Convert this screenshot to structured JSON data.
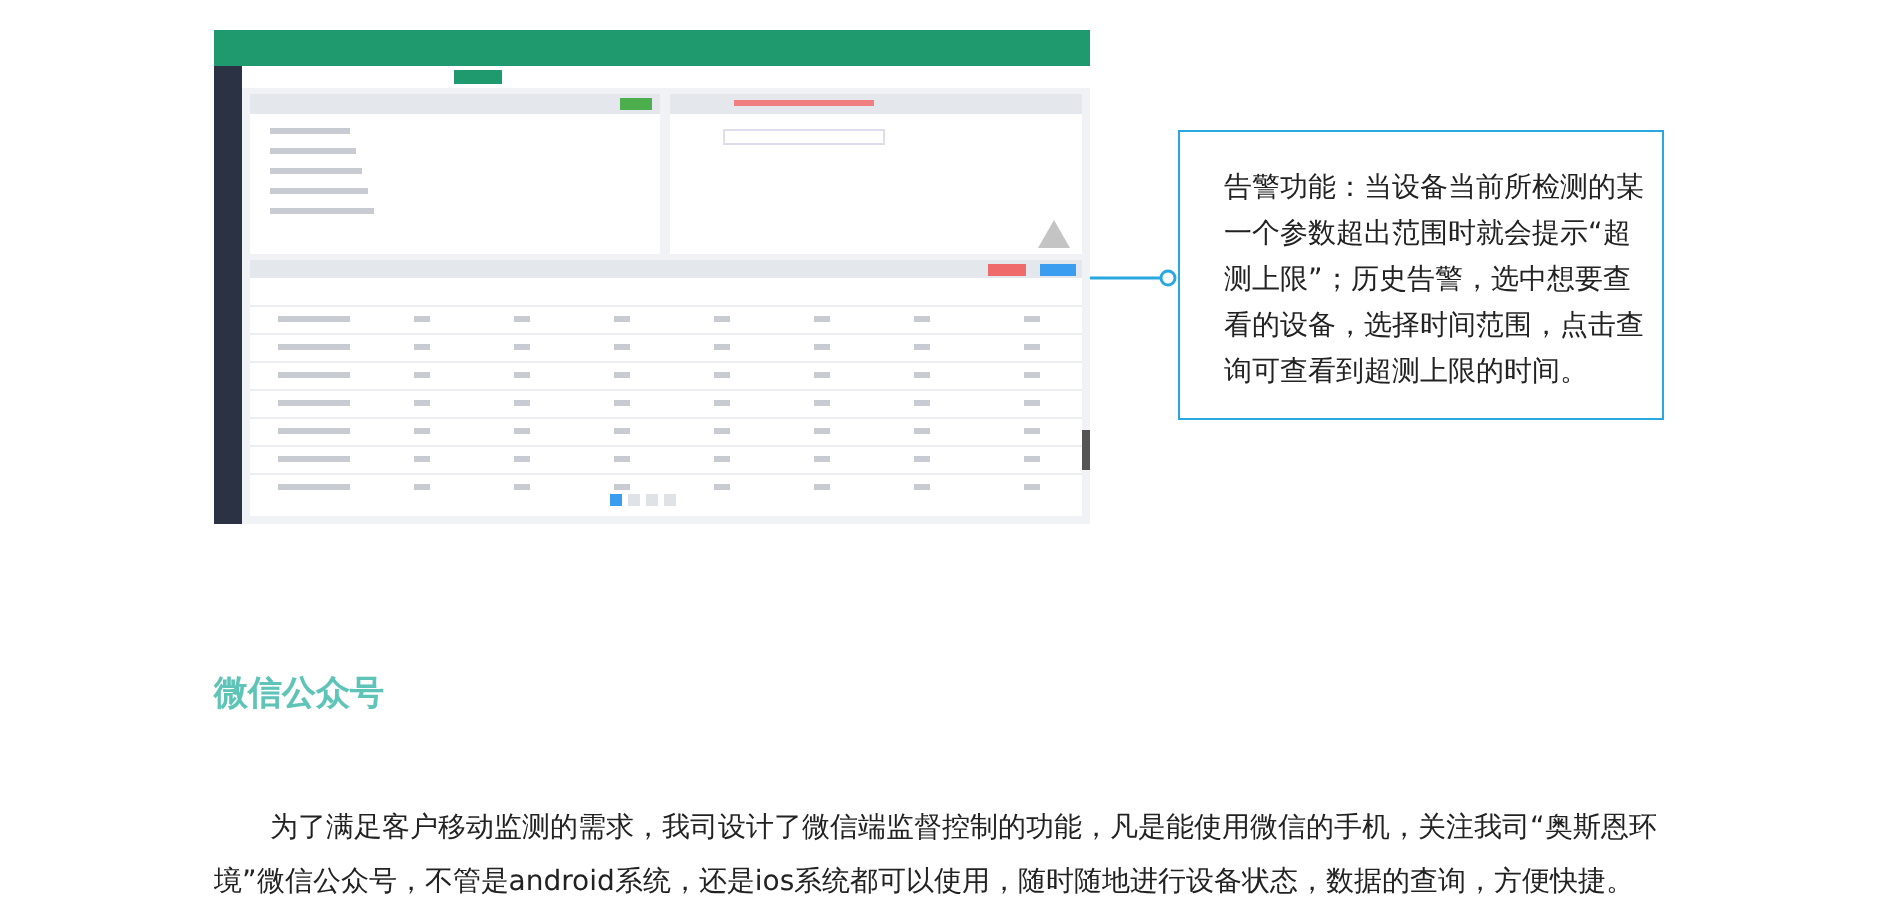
{
  "callout": {
    "text": "告警功能：当设备当前所检测的某一个参数超出范围时就会提示“超测上限”；历史告警，选中想要查看的设备，选择时间范围，点击查询可查看到超测上限的时间。"
  },
  "section": {
    "title": "微信公众号",
    "paragraph": "为了满足客户移动监测的需求，我司设计了微信端监督控制的功能，凡是能使用微信的手机，关注我司“奥斯恩环境”微信公众号，不管是android系统，还是ios系统都可以使用，随时随地进行设备状态，数据的查询，方便快捷。"
  }
}
